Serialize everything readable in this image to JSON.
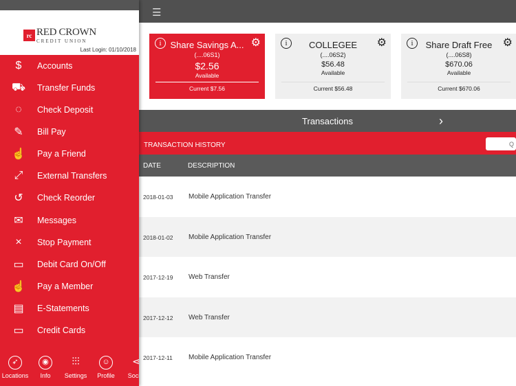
{
  "sidebar": {
    "logo": "RED CROWN CREDIT UNION",
    "last_login": "Last Login:  01/10/2018",
    "items": [
      {
        "label": "Accounts",
        "icon": "dollar-icon"
      },
      {
        "label": "Transfer Funds",
        "icon": "truck-icon"
      },
      {
        "label": "Check Deposit",
        "icon": "piggy-bank-icon"
      },
      {
        "label": "Bill Pay",
        "icon": "check-icon"
      },
      {
        "label": "Pay a Friend",
        "icon": "hand-coins-icon"
      },
      {
        "label": "External Transfers",
        "icon": "arrows-icon"
      },
      {
        "label": "Check Reorder",
        "icon": "reorder-icon"
      },
      {
        "label": "Messages",
        "icon": "envelope-icon"
      },
      {
        "label": "Stop Payment",
        "icon": "x-icon"
      },
      {
        "label": "Debit Card On/Off",
        "icon": "card-icon"
      },
      {
        "label": "Pay a Member",
        "icon": "hand-coins-icon"
      },
      {
        "label": "E-Statements",
        "icon": "statement-icon"
      },
      {
        "label": "Credit Cards",
        "icon": "card-icon"
      }
    ],
    "bottom_nav": [
      {
        "label": "Locations",
        "icon": "compass-icon"
      },
      {
        "label": "Info",
        "icon": "info-icon"
      },
      {
        "label": "Settings",
        "icon": "sliders-icon"
      },
      {
        "label": "Profile",
        "icon": "profile-icon"
      },
      {
        "label": "Social",
        "icon": "share-icon"
      }
    ]
  },
  "accounts": [
    {
      "name": "Share Savings A...",
      "number": "(....06S1)",
      "amount": "$2.56",
      "available": "Available",
      "current": "Current $7.56",
      "active": true
    },
    {
      "name": "COLLEGEE",
      "number": "(....06S2)",
      "amount": "$56.48",
      "available": "Available",
      "current": "Current $56.48"
    },
    {
      "name": "Share Draft Free",
      "number": "(....06S8)",
      "amount": "$670.06",
      "available": "Available",
      "current": "Current $670.06"
    }
  ],
  "transactions_label": "Transactions",
  "history": {
    "title": "TRANSACTION HISTORY",
    "search_placeholder": "Q",
    "columns": [
      "DATE",
      "DESCRIPTION"
    ],
    "rows": [
      {
        "date": "2018-01-03",
        "desc": "Mobile Application Transfer"
      },
      {
        "date": "2018-01-02",
        "desc": "Mobile Application Transfer"
      },
      {
        "date": "2017-12-19",
        "desc": "Web Transfer"
      },
      {
        "date": "2017-12-12",
        "desc": "Web Transfer"
      },
      {
        "date": "2017-12-11",
        "desc": "Mobile Application Transfer"
      }
    ]
  },
  "colors": {
    "brand_red": "#e11f2e",
    "dark_gray": "#555555"
  }
}
